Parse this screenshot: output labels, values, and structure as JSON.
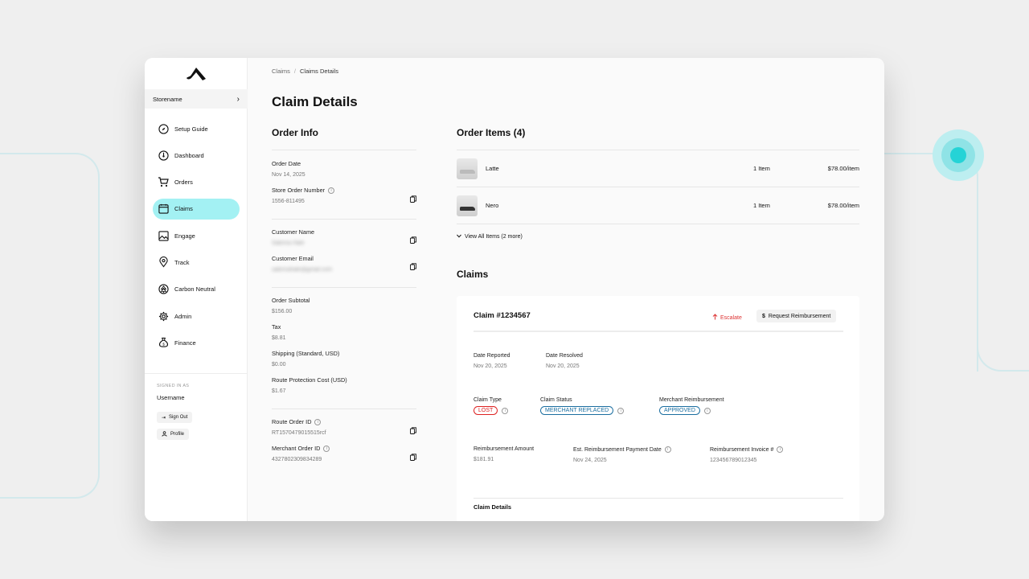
{
  "sidebar": {
    "store_name": "Storename",
    "items": [
      {
        "label": "Setup Guide",
        "icon": "compass-icon"
      },
      {
        "label": "Dashboard",
        "icon": "gauge-icon"
      },
      {
        "label": "Orders",
        "icon": "cart-icon"
      },
      {
        "label": "Claims",
        "icon": "claims-icon",
        "active": true
      },
      {
        "label": "Engage",
        "icon": "image-icon"
      },
      {
        "label": "Track",
        "icon": "location-pin-icon"
      },
      {
        "label": "Carbon Neutral",
        "icon": "tree-icon"
      },
      {
        "label": "Admin",
        "icon": "gear-icon"
      },
      {
        "label": "Finance",
        "icon": "money-bag-icon"
      }
    ],
    "signed_in_label": "SIGNED IN AS",
    "username": "Username",
    "sign_out": "Sign Out",
    "profile": "Profile"
  },
  "breadcrumb": {
    "root": "Claims",
    "sep": "/",
    "current": "Claims Details"
  },
  "page_title": "Claim Details",
  "order_info": {
    "title": "Order Info",
    "order_date_label": "Order Date",
    "order_date": "Nov 14, 2025",
    "store_order_number_label": "Store Order Number",
    "store_order_number": "1556-811495",
    "customer_name_label": "Customer Name",
    "customer_name": "Sabrina Hale",
    "customer_email_label": "Customer Email",
    "customer_email": "sabrinahale@gmail.com",
    "subtotal_label": "Order Subtotal",
    "subtotal": "$156.00",
    "tax_label": "Tax",
    "tax": "$8.81",
    "shipping_label": "Shipping (Standard, USD)",
    "shipping": "$0.00",
    "route_cost_label": "Route Protection Cost (USD)",
    "route_cost": "$1.67",
    "route_order_id_label": "Route Order ID",
    "route_order_id": "RT1570479015515rcf",
    "merchant_order_id_label": "Merchant Order ID",
    "merchant_order_id": "4327802309834289"
  },
  "order_items": {
    "title": "Order Items (4)",
    "items": [
      {
        "name": "Latte",
        "qty": "1 Item",
        "price": "$78.00/item"
      },
      {
        "name": "Nero",
        "qty": "1 Item",
        "price": "$78.00/item"
      }
    ],
    "view_all": "View All Items (2 more)"
  },
  "claims": {
    "title": "Claims",
    "claim_id": "Claim #1234567",
    "escalate": "Escalate",
    "request_reimbursement": "Request Reimbursement",
    "date_reported_label": "Date Reported",
    "date_reported": "Nov 20, 2025",
    "date_resolved_label": "Date Resolved",
    "date_resolved": "Nov 20, 2025",
    "claim_type_label": "Claim Type",
    "claim_type": "LOST",
    "claim_status_label": "Claim Status",
    "claim_status": "MERCHANT REPLACED",
    "merchant_reimb_label": "Merchant Reimbursement",
    "merchant_reimb": "APPROVED",
    "reimb_amount_label": "Reimbursement Amount",
    "reimb_amount": "$181.91",
    "est_payment_label": "Est. Reimbursement Payment Date",
    "est_payment": "Nov 24, 2025",
    "invoice_label": "Reimbursement Invoice #",
    "invoice": "123456789012345",
    "claim_details": "Claim Details"
  },
  "colors": {
    "accent": "#a3f1f3",
    "danger": "#dd2222",
    "info": "#1b6ea0"
  }
}
